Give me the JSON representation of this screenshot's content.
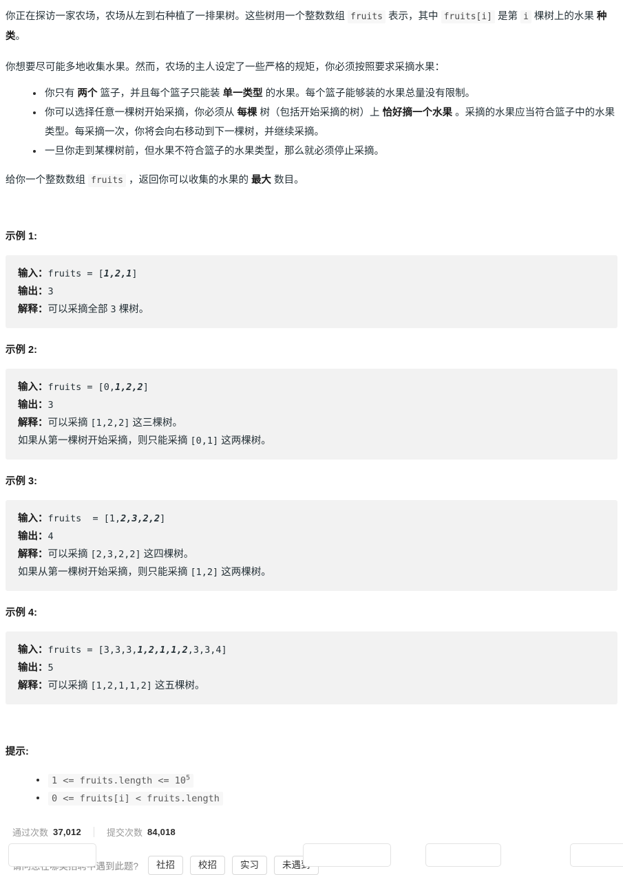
{
  "intro": {
    "line1_a": "你正在探访一家农场，农场从左到右种植了一排果树。这些树用一个整数数组 ",
    "code_fruits": "fruits",
    "line1_b": " 表示，其中 ",
    "code_fruits_i": "fruits[i]",
    "line1_c": " 是第 ",
    "code_i": "i",
    "line1_d": " 棵树上的水果 ",
    "bold_kind": "种类",
    "line1_e": "。",
    "line2": "你想要尽可能多地收集水果。然而，农场的主人设定了一些严格的规矩，你必须按照要求采摘水果："
  },
  "rules": [
    {
      "a": "你只有 ",
      "b1": "两个",
      "c": " 篮子，并且每个篮子只能装 ",
      "b2": "单一类型",
      "d": " 的水果。每个篮子能够装的水果总量没有限制。"
    },
    {
      "a": "你可以选择任意一棵树开始采摘，你必须从 ",
      "b1": "每棵",
      "c": " 树（包括开始采摘的树）上 ",
      "b2": "恰好摘一个水果",
      "d": " 。采摘的水果应当符合篮子中的水果类型。每采摘一次，你将会向右移动到下一棵树，并继续采摘。"
    },
    {
      "a": "一旦你走到某棵树前，但水果不符合篮子的水果类型，那么就必须停止采摘。",
      "b1": "",
      "c": "",
      "b2": "",
      "d": ""
    }
  ],
  "task": {
    "a": "给你一个整数数组 ",
    "code": "fruits",
    "b": " ，返回你可以收集的水果的 ",
    "bold": "最大",
    "c": " 数目。"
  },
  "labels": {
    "input": "输入：",
    "output": "输出：",
    "explain": "解释："
  },
  "examples": [
    {
      "title": "示例 1:",
      "input_var": "fruits = [",
      "input_plain_pre": "",
      "input_em": "1,2,1",
      "input_plain_post": "",
      "input_close": "]",
      "output": "3",
      "explain_lines": [
        {
          "a": "可以采摘全部 ",
          "code": "3",
          "b": " 棵树。"
        }
      ]
    },
    {
      "title": "示例 2:",
      "input_var": "fruits = [",
      "input_plain_pre": "0,",
      "input_em": "1,2,2",
      "input_plain_post": "",
      "input_close": "]",
      "output": "3",
      "explain_lines": [
        {
          "a": "可以采摘 ",
          "code": "[1,2,2]",
          "b": " 这三棵树。"
        },
        {
          "a": "如果从第一棵树开始采摘，则只能采摘 ",
          "code": "[0,1]",
          "b": " 这两棵树。"
        }
      ]
    },
    {
      "title": "示例 3:",
      "input_var": "fruits  = [",
      "input_plain_pre": "1,",
      "input_em": "2,3,2,2",
      "input_plain_post": "",
      "input_close": "]",
      "output": "4",
      "explain_lines": [
        {
          "a": "可以采摘 ",
          "code": "[2,3,2,2]",
          "b": " 这四棵树。"
        },
        {
          "a": "如果从第一棵树开始采摘，则只能采摘 ",
          "code": "[1,2]",
          "b": " 这两棵树。"
        }
      ]
    },
    {
      "title": "示例 4:",
      "input_var": "fruits = [",
      "input_plain_pre": "3,3,3,",
      "input_em": "1,2,1,1,2",
      "input_plain_post": ",3,3,4",
      "input_close": "]",
      "output": "5",
      "explain_lines": [
        {
          "a": "可以采摘 ",
          "code": "[1,2,1,1,2]",
          "b": " 这五棵树。"
        }
      ]
    }
  ],
  "hints": {
    "title": "提示:",
    "items": [
      {
        "text_pre": "1 <= fruits.length <= 10",
        "sup": "5",
        "text_post": ""
      },
      {
        "text_pre": "0 <= fruits[i] < fruits.length",
        "sup": "",
        "text_post": ""
      }
    ]
  },
  "stats": {
    "accepted_label": "通过次数",
    "accepted_value": "37,012",
    "submissions_label": "提交次数",
    "submissions_value": "84,018"
  },
  "survey": {
    "question": "请问您在哪类招聘中遇到此题?",
    "options": [
      "社招",
      "校招",
      "实习",
      "未遇到"
    ]
  },
  "colors": {
    "text": "#263238",
    "code_bg": "#f2f2f2",
    "chip_bg": "#f7f7f7",
    "muted": "#9a9a9a",
    "border": "#d9d9d9"
  }
}
